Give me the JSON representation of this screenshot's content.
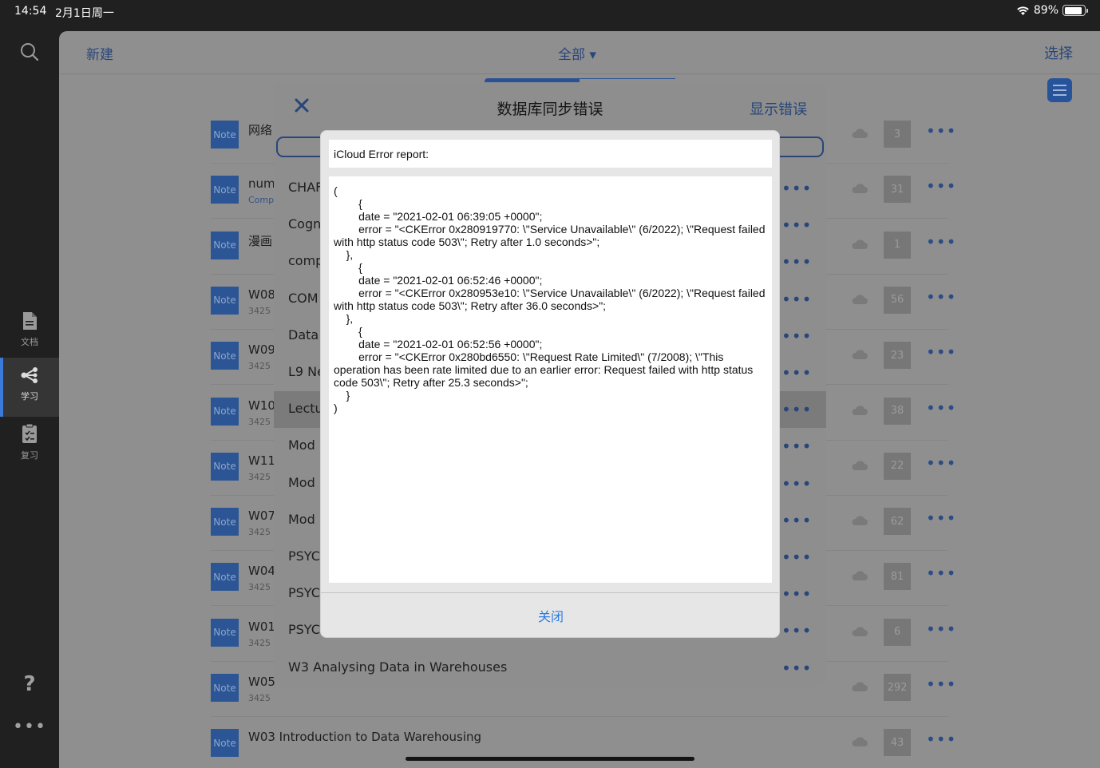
{
  "status_bar": {
    "time": "14:54",
    "date": "2月1日周一",
    "battery": "89%",
    "battery_level": 0.89
  },
  "sidebar": {
    "items": [
      {
        "label": "文档",
        "icon": "document-icon"
      },
      {
        "label": "学习",
        "icon": "share-nodes-icon",
        "active": true
      },
      {
        "label": "复习",
        "icon": "clipboard-check-icon"
      }
    ],
    "help_icon": "?",
    "more_icon": "•••"
  },
  "topbar": {
    "new_label": "新建",
    "filter_label": "全部 ▾",
    "select_label": "选择"
  },
  "list": {
    "badge_label": "Note",
    "more_glyph": "•••",
    "rows": [
      {
        "title": "网络",
        "subtitle": "",
        "count": "3"
      },
      {
        "title": "num",
        "subtitle": "Comp",
        "count": "31"
      },
      {
        "title": "漫画",
        "subtitle": "",
        "count": "1"
      },
      {
        "title": "W08",
        "subtitle": "3425",
        "count": "56"
      },
      {
        "title": "W09",
        "subtitle": "3425",
        "count": "23"
      },
      {
        "title": "W10",
        "subtitle": "3425",
        "count": "38"
      },
      {
        "title": "W11",
        "subtitle": "3425",
        "count": "22"
      },
      {
        "title": "W07",
        "subtitle": "3425",
        "count": "62"
      },
      {
        "title": "W04",
        "subtitle": "3425",
        "count": "81"
      },
      {
        "title": "W01",
        "subtitle": "3425",
        "count": "6"
      },
      {
        "title": "W05-06 Classification & Prediction",
        "subtitle": "3425",
        "count": "292"
      },
      {
        "title": "W03 Introduction to Data Warehousing",
        "subtitle": "",
        "count": "43"
      }
    ]
  },
  "sync_dialog": {
    "title": "数据库同步错误",
    "show_errors_label": "显示错误",
    "rows": [
      {
        "text": "CHAF"
      },
      {
        "text": "Cogn"
      },
      {
        "text": "comp"
      },
      {
        "text": "COM"
      },
      {
        "text": "Data"
      },
      {
        "text": "L9 Ne"
      },
      {
        "text": "Lectu",
        "selected": true
      },
      {
        "text": "Mod"
      },
      {
        "text": "Mod"
      },
      {
        "text": "Mod"
      },
      {
        "text": "PSYC"
      },
      {
        "text": "PSYC"
      },
      {
        "text": "PSYC"
      },
      {
        "text": "W3 Analysing Data in Warehouses"
      }
    ],
    "more_glyph": "•••"
  },
  "error_alert": {
    "header": "iCloud Error report:",
    "body": "(\n        {\n        date = \"2021-02-01 06:39:05 +0000\";\n        error = \"<CKError 0x280919770: \\\"Service Unavailable\\\" (6/2022); \\\"Request failed with http status code 503\\\"; Retry after 1.0 seconds>\";\n    },\n        {\n        date = \"2021-02-01 06:52:46 +0000\";\n        error = \"<CKError 0x280953e10: \\\"Service Unavailable\\\" (6/2022); \\\"Request failed with http status code 503\\\"; Retry after 36.0 seconds>\";\n    },\n        {\n        date = \"2021-02-01 06:52:56 +0000\";\n        error = \"<CKError 0x280bd6550: \\\"Request Rate Limited\\\" (7/2008); \\\"This operation has been rate limited due to an earlier error: Request failed with http status code 503\\\"; Retry after 25.3 seconds>\";\n    }\n)",
    "close_label": "关闭"
  },
  "colors": {
    "accent": "#2e7be0",
    "sidebar_active": "#3b7ad9",
    "badge": "#2b5594"
  }
}
